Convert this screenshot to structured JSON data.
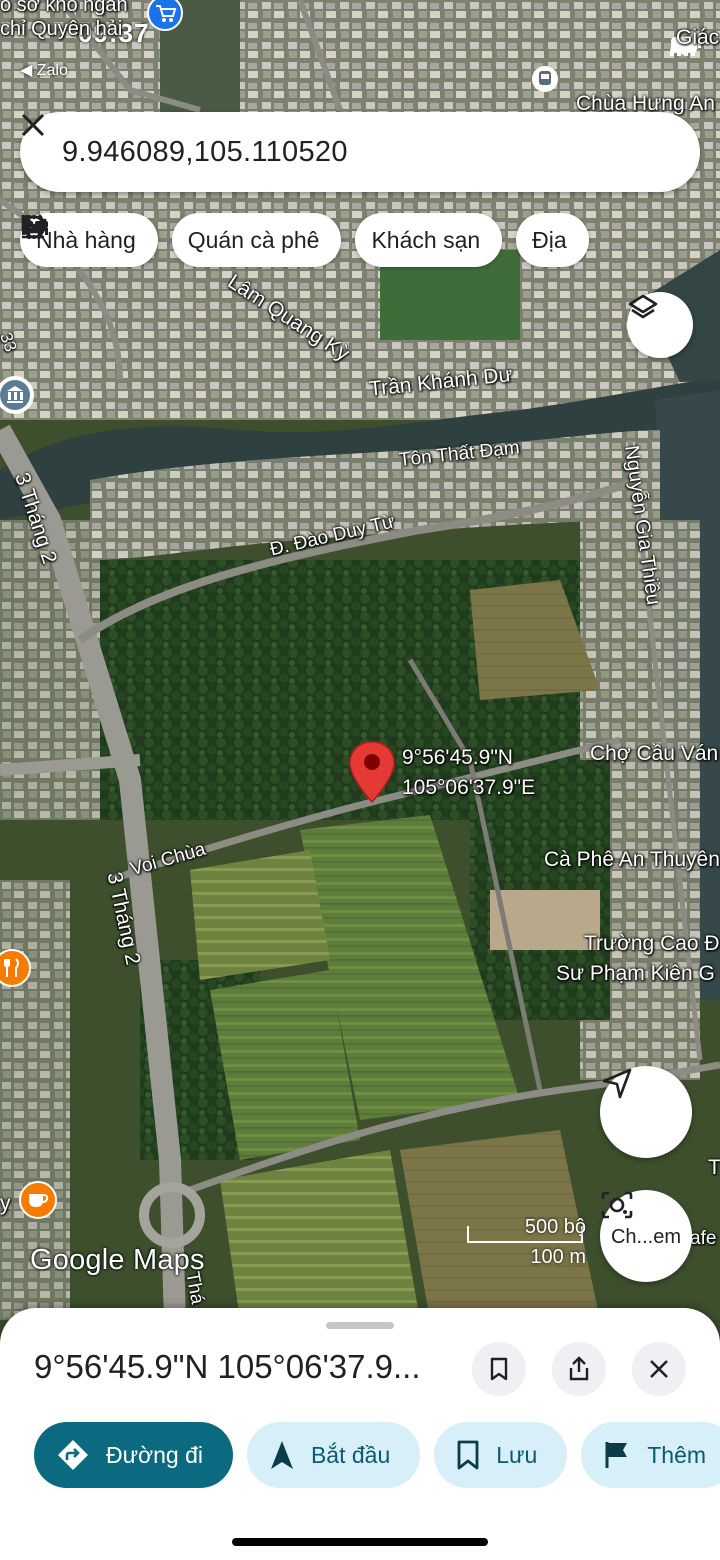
{
  "status_bar": {
    "time": "09:37",
    "back_app": "◀ Zalo"
  },
  "search": {
    "value": "9.946089,105.110520"
  },
  "chips": [
    {
      "label": "Nhà hàng",
      "icon": "restaurant-icon"
    },
    {
      "label": "Quán cà phê",
      "icon": "cafe-icon"
    },
    {
      "label": "Khách sạn",
      "icon": "hotel-icon"
    },
    {
      "label": "Địa",
      "icon": "attractions-icon"
    }
  ],
  "map": {
    "labels": {
      "top_left": "o sở kho ngắn",
      "top_left2": "chỉ Quyên hải",
      "top_right": "Giác",
      "chua_hung_an": "Chùa Hưng An",
      "lam_quang_ky": "Lâm Quang Kỳ",
      "tran_khanh_du": "Trần Khánh Dư",
      "ton_that_dam": "Tôn Thất Đạm",
      "dao_duy_tu": "Đ. Đào Duy Từ",
      "nguyen_gia_thieu": "Nguyễn Gia Thiều",
      "three_thang_2_top": "3 Tháng 2",
      "three_thang_2_bottom": "3 Tháng 2",
      "voi_chua": "Voi Chùa",
      "cho_cau_van": "Chợ Cầu Ván",
      "ca_phe_an_thuyen": "Cà Phê An Thuyên",
      "truong_cao_dang_1": "Trường Cao Đ",
      "truong_cao_dang_2": "Sư Phạm Kiên G",
      "route_33": "33",
      "left_edge_y": "y",
      "right_edge_afe": "afe",
      "right_edge_t": "T",
      "bottom_tha": "Thá"
    },
    "pin": {
      "lat_label": "9°56'45.9\"N",
      "lon_label": "105°06'37.9\"E",
      "color": "#e53935"
    },
    "attribution": "Google Maps",
    "scale": {
      "top": "500 bộ",
      "bottom": "100 m"
    },
    "lens_label": "Ch...em"
  },
  "sheet": {
    "title": "9°56'45.9\"N 105°06'37.9...",
    "actions": [
      {
        "label": "Đường đi",
        "icon": "directions-icon"
      },
      {
        "label": "Bắt đầu",
        "icon": "navigate-icon"
      },
      {
        "label": "Lưu",
        "icon": "bookmark-icon"
      },
      {
        "label": "Thêm",
        "icon": "flag-icon"
      }
    ]
  },
  "colors": {
    "accent": "#0b6a80",
    "action_bg": "#d6eff8",
    "pin": "#e53935"
  }
}
